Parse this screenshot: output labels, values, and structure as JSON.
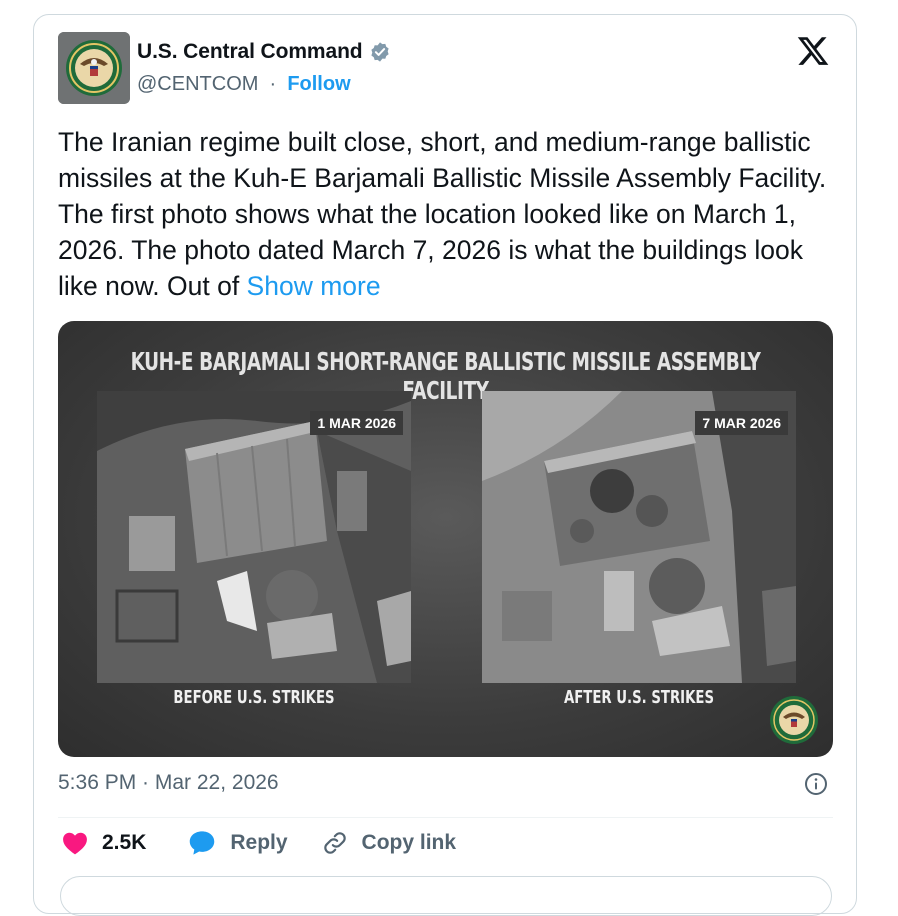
{
  "author": {
    "name": "U.S. Central Command",
    "handle": "@CENTCOM",
    "separator": "·",
    "follow_label": "Follow"
  },
  "tweet": {
    "text": "The Iranian regime built close, short, and medium-range ballistic missiles at the Kuh-E Barjamali Ballistic Missile Assembly Facility. The first photo shows what the location looked like on March 1, 2026. The photo dated March 7, 2026 is what the buildings look like now. Out of ",
    "show_more_label": "Show more"
  },
  "media": {
    "title": "KUH-E BARJAMALI SHORT-RANGE BALLISTIC MISSILE ASSEMBLY FACILITY",
    "before": {
      "date": "1 MAR 2026",
      "caption": "BEFORE U.S. STRIKES"
    },
    "after": {
      "date": "7 MAR 2026",
      "caption": "AFTER U.S. STRIKES"
    }
  },
  "meta": {
    "timestamp": "5:36 PM · Mar 22, 2026"
  },
  "actions": {
    "like_count": "2.5K",
    "reply_label": "Reply",
    "copy_link_label": "Copy link"
  },
  "colors": {
    "accent": "#1d9bf0",
    "like": "#f91880",
    "secondary_text": "#536471"
  },
  "icons": [
    "verified-badge-icon",
    "x-logo-icon",
    "info-icon",
    "heart-icon",
    "reply-bubble-icon",
    "link-icon"
  ]
}
